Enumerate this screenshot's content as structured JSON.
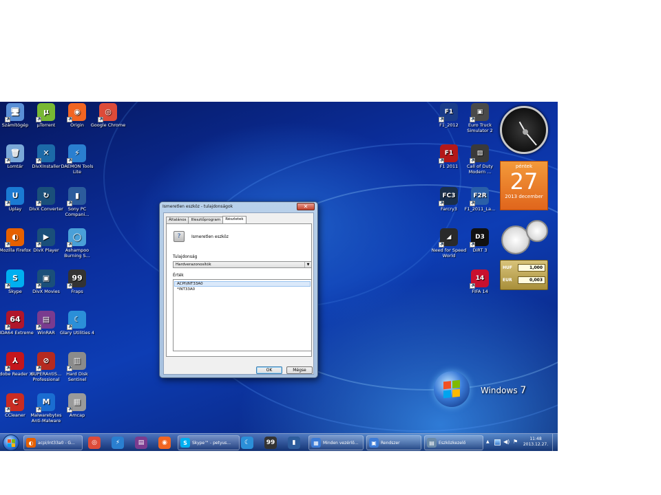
{
  "desktop_left": [
    {
      "label": "Számítógép",
      "glyph": "🖥",
      "color": "#5a8fd6"
    },
    {
      "label": "µTorrent",
      "glyph": "µ",
      "color": "#78b833"
    },
    {
      "label": "Origin",
      "glyph": "◉",
      "color": "#f26522"
    },
    {
      "label": "Google Chrome",
      "glyph": "◎",
      "color": "#dd4b39"
    },
    {
      "label": "Lomtár",
      "glyph": "🗑",
      "color": "#7aa8d8"
    },
    {
      "label": "DivXInstaller",
      "glyph": "✕",
      "color": "#1c6aa8"
    },
    {
      "label": "DAEMON Tools Lite",
      "glyph": "⚡",
      "color": "#2a7fd0"
    },
    {
      "label": "Uplay",
      "glyph": "U",
      "color": "#1a7ad3"
    },
    {
      "label": "DivX Converter",
      "glyph": "↻",
      "color": "#1a4f7a"
    },
    {
      "label": "Sony PC Compani...",
      "glyph": "▮",
      "color": "#2c5c9c"
    },
    {
      "label": "Mozilla Firefox",
      "glyph": "◐",
      "color": "#e66000"
    },
    {
      "label": "DivX Player",
      "glyph": "▶",
      "color": "#1a4f7a"
    },
    {
      "label": "Ashampoo Burning S...",
      "glyph": "◯",
      "color": "#4aa0d8"
    },
    {
      "label": "Skype",
      "glyph": "S",
      "color": "#00aff0"
    },
    {
      "label": "DivX Movies",
      "glyph": "▣",
      "color": "#1a4f7a"
    },
    {
      "label": "Fraps",
      "glyph": "99",
      "color": "#333333"
    },
    {
      "label": "AIDA64 Extreme",
      "glyph": "64",
      "color": "#b0162b"
    },
    {
      "label": "WinRAR",
      "glyph": "▤",
      "color": "#7a3b8f"
    },
    {
      "label": "Glary Utilities 4",
      "glyph": "☾",
      "color": "#2b8fd8"
    },
    {
      "label": "Adobe Reader XI",
      "glyph": "⅄",
      "color": "#c4161c"
    },
    {
      "label": "SUPERAntiS... Professional",
      "glyph": "⊘",
      "color": "#b52a1f"
    },
    {
      "label": "Hard Disk Sentinel",
      "glyph": "▥",
      "color": "#8b8b8b"
    },
    {
      "label": "CCleaner",
      "glyph": "C",
      "color": "#c92c22"
    },
    {
      "label": "Malwarebytes Anti-Malware",
      "glyph": "M",
      "color": "#1a6dd1"
    },
    {
      "label": "Amcap",
      "glyph": "▦",
      "color": "#9a9a9a"
    }
  ],
  "desktop_right": [
    {
      "label": "F1_2012",
      "glyph": "F1",
      "color": "#1a3c8a"
    },
    {
      "label": "Euro Truck Simulator 2",
      "glyph": "▣",
      "color": "#4a4a4a"
    },
    {
      "label": "F1 2011",
      "glyph": "F1",
      "color": "#b41818"
    },
    {
      "label": "Call of Duty Modern ...",
      "glyph": "▨",
      "color": "#3a3a3a"
    },
    {
      "label": "Farcry3",
      "glyph": "FC3",
      "color": "#1a2f4a"
    },
    {
      "label": "F1_2011_La...",
      "glyph": "F2R",
      "color": "#2a5fa8"
    },
    {
      "label": "Need for Speed World",
      "glyph": "◢",
      "color": "#2a2a2a"
    },
    {
      "label": "DiRT 3",
      "glyph": "D3",
      "color": "#111111"
    },
    {
      "label": "FIFA 14",
      "glyph": "14",
      "color": "#c8102e"
    }
  ],
  "calendar": {
    "weekday": "péntek",
    "day": "27",
    "month_year": "2013 december"
  },
  "currency": {
    "rows": [
      {
        "code": "HUF",
        "value": "1,000"
      },
      {
        "code": "EUR",
        "value": "0,003"
      }
    ]
  },
  "win7": {
    "windows": "Windows",
    "version": "7"
  },
  "dialog": {
    "title": "Ismeretlen eszköz - tulajdonságok",
    "close": "✕",
    "tabs": [
      "Általános",
      "Illesztőprogram",
      "Részletek"
    ],
    "device_name": "Ismeretlen eszköz",
    "property_label": "Tulajdonság",
    "property_value": "Hardverazonosítók",
    "value_label": "Érték",
    "values": [
      "ACPI\\INT33A0",
      "*INT33A0"
    ],
    "ok": "OK",
    "cancel": "Mégse"
  },
  "taskbar": {
    "buttons": [
      {
        "label": "acpi/int33a0 - G...",
        "glyph": "◐",
        "color": "#e66000"
      },
      {
        "label": "Skype™ - petyus...",
        "glyph": "S",
        "color": "#00aff0"
      },
      {
        "label": "Minden vezérlő...",
        "glyph": "▦",
        "color": "#3c7bd6"
      },
      {
        "label": "Rendszer",
        "glyph": "▣",
        "color": "#3c7bd6"
      },
      {
        "label": "Eszközkezelő",
        "glyph": "▤",
        "color": "#6a8aa8"
      }
    ],
    "quick": [
      {
        "glyph": "◎",
        "color": "#dd4b39"
      },
      {
        "glyph": "⚡",
        "color": "#2a7fd0"
      },
      {
        "glyph": "▤",
        "color": "#7a3b8f"
      },
      {
        "glyph": "◉",
        "color": "#f26522"
      },
      {
        "glyph": "☾",
        "color": "#2b8fd8"
      },
      {
        "glyph": "99",
        "color": "#333333"
      },
      {
        "glyph": "▮",
        "color": "#2c5c9c"
      }
    ],
    "time": "11:48",
    "date": "2013.12.27.",
    "tray_up": "▲"
  }
}
